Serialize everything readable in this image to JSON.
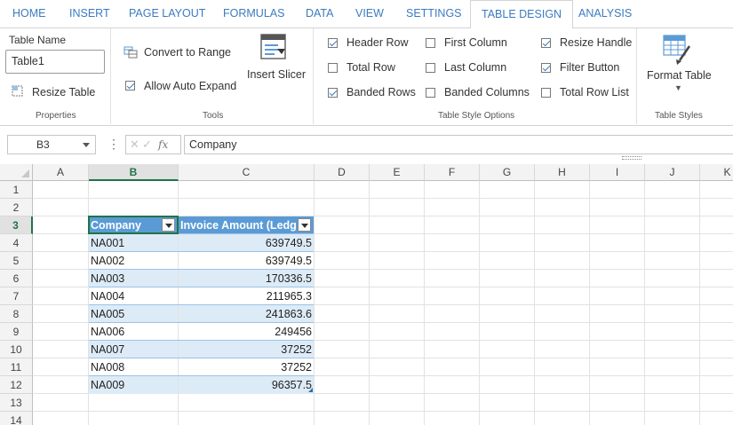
{
  "tabs": [
    "HOME",
    "INSERT",
    "PAGE LAYOUT",
    "FORMULAS",
    "DATA",
    "VIEW",
    "SETTINGS",
    "TABLE DESIGN",
    "ANALYSIS"
  ],
  "active_tab": "TABLE DESIGN",
  "ribbon": {
    "properties": {
      "table_name_label": "Table Name",
      "table_name_value": "Table1",
      "resize_table": "Resize Table",
      "group_label": "Properties"
    },
    "tools": {
      "convert_to_range": "Convert to Range",
      "allow_auto_expand": "Allow Auto Expand",
      "allow_auto_expand_checked": true,
      "insert_slicer": "Insert Slicer",
      "group_label": "Tools"
    },
    "style_options": {
      "header_row": "Header Row",
      "header_row_checked": true,
      "total_row": "Total Row",
      "total_row_checked": false,
      "banded_rows": "Banded Rows",
      "banded_rows_checked": true,
      "first_column": "First Column",
      "first_column_checked": false,
      "last_column": "Last Column",
      "last_column_checked": false,
      "banded_columns": "Banded Columns",
      "banded_columns_checked": false,
      "resize_handle": "Resize Handle",
      "resize_handle_checked": true,
      "filter_button": "Filter Button",
      "filter_button_checked": true,
      "total_row_list": "Total Row List",
      "total_row_list_checked": false,
      "group_label": "Table Style Options"
    },
    "table_styles": {
      "format_table": "Format Table",
      "group_label": "Table Styles"
    }
  },
  "formula_bar": {
    "name_box": "B3",
    "fx_icon": "fx",
    "formula": "Company"
  },
  "columns": [
    "A",
    "B",
    "C",
    "D",
    "E",
    "F",
    "G",
    "H",
    "I",
    "J",
    "K"
  ],
  "rows": [
    "1",
    "2",
    "3",
    "4",
    "5",
    "6",
    "7",
    "8",
    "9",
    "10",
    "11",
    "12",
    "13",
    "14"
  ],
  "selected_cell": "B3",
  "table": {
    "headers": [
      "Company",
      "Invoice Amount (Ledg"
    ],
    "rows": [
      [
        "NA001",
        "639749.5"
      ],
      [
        "NA002",
        "639749.5"
      ],
      [
        "NA003",
        "170336.5"
      ],
      [
        "NA004",
        "211965.3"
      ],
      [
        "NA005",
        "241863.6"
      ],
      [
        "NA006",
        "249456"
      ],
      [
        "NA007",
        "37252"
      ],
      [
        "NA008",
        "37252"
      ],
      [
        "NA009",
        "96357.5"
      ]
    ]
  },
  "colors": {
    "accent": "#3b7bbf",
    "table_header": "#5b9bd5",
    "band": "#ddebf7",
    "selection": "#217346"
  }
}
